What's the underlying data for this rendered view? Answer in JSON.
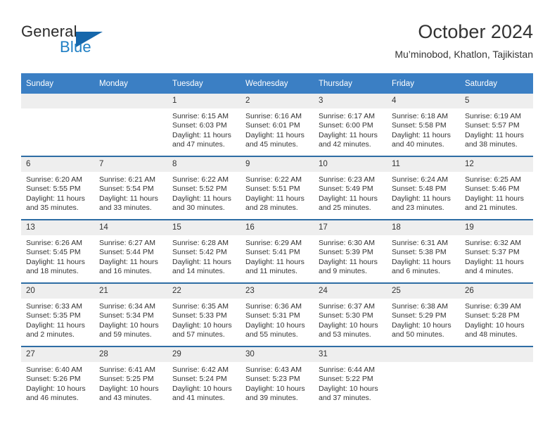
{
  "brand": {
    "line1": "General",
    "line2": "Blue",
    "triangle_color": "#1667ab",
    "blue_text_color": "#1f7fc4"
  },
  "header": {
    "title": "October 2024",
    "subtitle": "Mu’minobod, Khatlon, Tajikistan"
  },
  "theme": {
    "header_bg": "#3b7fc4",
    "row_separator": "#2e6da4",
    "daynum_bg": "#eeeeee",
    "text": "#333333"
  },
  "calendar": {
    "weekday_headers": [
      "Sunday",
      "Monday",
      "Tuesday",
      "Wednesday",
      "Thursday",
      "Friday",
      "Saturday"
    ],
    "weeks": [
      [
        {
          "day": "",
          "empty": true,
          "sunrise": "",
          "sunset": "",
          "daylight_1": "",
          "daylight_2": ""
        },
        {
          "day": "",
          "empty": true,
          "sunrise": "",
          "sunset": "",
          "daylight_1": "",
          "daylight_2": ""
        },
        {
          "day": "1",
          "sunrise": "Sunrise: 6:15 AM",
          "sunset": "Sunset: 6:03 PM",
          "daylight_1": "Daylight: 11 hours",
          "daylight_2": "and 47 minutes."
        },
        {
          "day": "2",
          "sunrise": "Sunrise: 6:16 AM",
          "sunset": "Sunset: 6:01 PM",
          "daylight_1": "Daylight: 11 hours",
          "daylight_2": "and 45 minutes."
        },
        {
          "day": "3",
          "sunrise": "Sunrise: 6:17 AM",
          "sunset": "Sunset: 6:00 PM",
          "daylight_1": "Daylight: 11 hours",
          "daylight_2": "and 42 minutes."
        },
        {
          "day": "4",
          "sunrise": "Sunrise: 6:18 AM",
          "sunset": "Sunset: 5:58 PM",
          "daylight_1": "Daylight: 11 hours",
          "daylight_2": "and 40 minutes."
        },
        {
          "day": "5",
          "sunrise": "Sunrise: 6:19 AM",
          "sunset": "Sunset: 5:57 PM",
          "daylight_1": "Daylight: 11 hours",
          "daylight_2": "and 38 minutes."
        }
      ],
      [
        {
          "day": "6",
          "sunrise": "Sunrise: 6:20 AM",
          "sunset": "Sunset: 5:55 PM",
          "daylight_1": "Daylight: 11 hours",
          "daylight_2": "and 35 minutes."
        },
        {
          "day": "7",
          "sunrise": "Sunrise: 6:21 AM",
          "sunset": "Sunset: 5:54 PM",
          "daylight_1": "Daylight: 11 hours",
          "daylight_2": "and 33 minutes."
        },
        {
          "day": "8",
          "sunrise": "Sunrise: 6:22 AM",
          "sunset": "Sunset: 5:52 PM",
          "daylight_1": "Daylight: 11 hours",
          "daylight_2": "and 30 minutes."
        },
        {
          "day": "9",
          "sunrise": "Sunrise: 6:22 AM",
          "sunset": "Sunset: 5:51 PM",
          "daylight_1": "Daylight: 11 hours",
          "daylight_2": "and 28 minutes."
        },
        {
          "day": "10",
          "sunrise": "Sunrise: 6:23 AM",
          "sunset": "Sunset: 5:49 PM",
          "daylight_1": "Daylight: 11 hours",
          "daylight_2": "and 25 minutes."
        },
        {
          "day": "11",
          "sunrise": "Sunrise: 6:24 AM",
          "sunset": "Sunset: 5:48 PM",
          "daylight_1": "Daylight: 11 hours",
          "daylight_2": "and 23 minutes."
        },
        {
          "day": "12",
          "sunrise": "Sunrise: 6:25 AM",
          "sunset": "Sunset: 5:46 PM",
          "daylight_1": "Daylight: 11 hours",
          "daylight_2": "and 21 minutes."
        }
      ],
      [
        {
          "day": "13",
          "sunrise": "Sunrise: 6:26 AM",
          "sunset": "Sunset: 5:45 PM",
          "daylight_1": "Daylight: 11 hours",
          "daylight_2": "and 18 minutes."
        },
        {
          "day": "14",
          "sunrise": "Sunrise: 6:27 AM",
          "sunset": "Sunset: 5:44 PM",
          "daylight_1": "Daylight: 11 hours",
          "daylight_2": "and 16 minutes."
        },
        {
          "day": "15",
          "sunrise": "Sunrise: 6:28 AM",
          "sunset": "Sunset: 5:42 PM",
          "daylight_1": "Daylight: 11 hours",
          "daylight_2": "and 14 minutes."
        },
        {
          "day": "16",
          "sunrise": "Sunrise: 6:29 AM",
          "sunset": "Sunset: 5:41 PM",
          "daylight_1": "Daylight: 11 hours",
          "daylight_2": "and 11 minutes."
        },
        {
          "day": "17",
          "sunrise": "Sunrise: 6:30 AM",
          "sunset": "Sunset: 5:39 PM",
          "daylight_1": "Daylight: 11 hours",
          "daylight_2": "and 9 minutes."
        },
        {
          "day": "18",
          "sunrise": "Sunrise: 6:31 AM",
          "sunset": "Sunset: 5:38 PM",
          "daylight_1": "Daylight: 11 hours",
          "daylight_2": "and 6 minutes."
        },
        {
          "day": "19",
          "sunrise": "Sunrise: 6:32 AM",
          "sunset": "Sunset: 5:37 PM",
          "daylight_1": "Daylight: 11 hours",
          "daylight_2": "and 4 minutes."
        }
      ],
      [
        {
          "day": "20",
          "sunrise": "Sunrise: 6:33 AM",
          "sunset": "Sunset: 5:35 PM",
          "daylight_1": "Daylight: 11 hours",
          "daylight_2": "and 2 minutes."
        },
        {
          "day": "21",
          "sunrise": "Sunrise: 6:34 AM",
          "sunset": "Sunset: 5:34 PM",
          "daylight_1": "Daylight: 10 hours",
          "daylight_2": "and 59 minutes."
        },
        {
          "day": "22",
          "sunrise": "Sunrise: 6:35 AM",
          "sunset": "Sunset: 5:33 PM",
          "daylight_1": "Daylight: 10 hours",
          "daylight_2": "and 57 minutes."
        },
        {
          "day": "23",
          "sunrise": "Sunrise: 6:36 AM",
          "sunset": "Sunset: 5:31 PM",
          "daylight_1": "Daylight: 10 hours",
          "daylight_2": "and 55 minutes."
        },
        {
          "day": "24",
          "sunrise": "Sunrise: 6:37 AM",
          "sunset": "Sunset: 5:30 PM",
          "daylight_1": "Daylight: 10 hours",
          "daylight_2": "and 53 minutes."
        },
        {
          "day": "25",
          "sunrise": "Sunrise: 6:38 AM",
          "sunset": "Sunset: 5:29 PM",
          "daylight_1": "Daylight: 10 hours",
          "daylight_2": "and 50 minutes."
        },
        {
          "day": "26",
          "sunrise": "Sunrise: 6:39 AM",
          "sunset": "Sunset: 5:28 PM",
          "daylight_1": "Daylight: 10 hours",
          "daylight_2": "and 48 minutes."
        }
      ],
      [
        {
          "day": "27",
          "sunrise": "Sunrise: 6:40 AM",
          "sunset": "Sunset: 5:26 PM",
          "daylight_1": "Daylight: 10 hours",
          "daylight_2": "and 46 minutes."
        },
        {
          "day": "28",
          "sunrise": "Sunrise: 6:41 AM",
          "sunset": "Sunset: 5:25 PM",
          "daylight_1": "Daylight: 10 hours",
          "daylight_2": "and 43 minutes."
        },
        {
          "day": "29",
          "sunrise": "Sunrise: 6:42 AM",
          "sunset": "Sunset: 5:24 PM",
          "daylight_1": "Daylight: 10 hours",
          "daylight_2": "and 41 minutes."
        },
        {
          "day": "30",
          "sunrise": "Sunrise: 6:43 AM",
          "sunset": "Sunset: 5:23 PM",
          "daylight_1": "Daylight: 10 hours",
          "daylight_2": "and 39 minutes."
        },
        {
          "day": "31",
          "sunrise": "Sunrise: 6:44 AM",
          "sunset": "Sunset: 5:22 PM",
          "daylight_1": "Daylight: 10 hours",
          "daylight_2": "and 37 minutes."
        },
        {
          "day": "",
          "empty": true,
          "sunrise": "",
          "sunset": "",
          "daylight_1": "",
          "daylight_2": ""
        },
        {
          "day": "",
          "empty": true,
          "sunrise": "",
          "sunset": "",
          "daylight_1": "",
          "daylight_2": ""
        }
      ]
    ]
  }
}
